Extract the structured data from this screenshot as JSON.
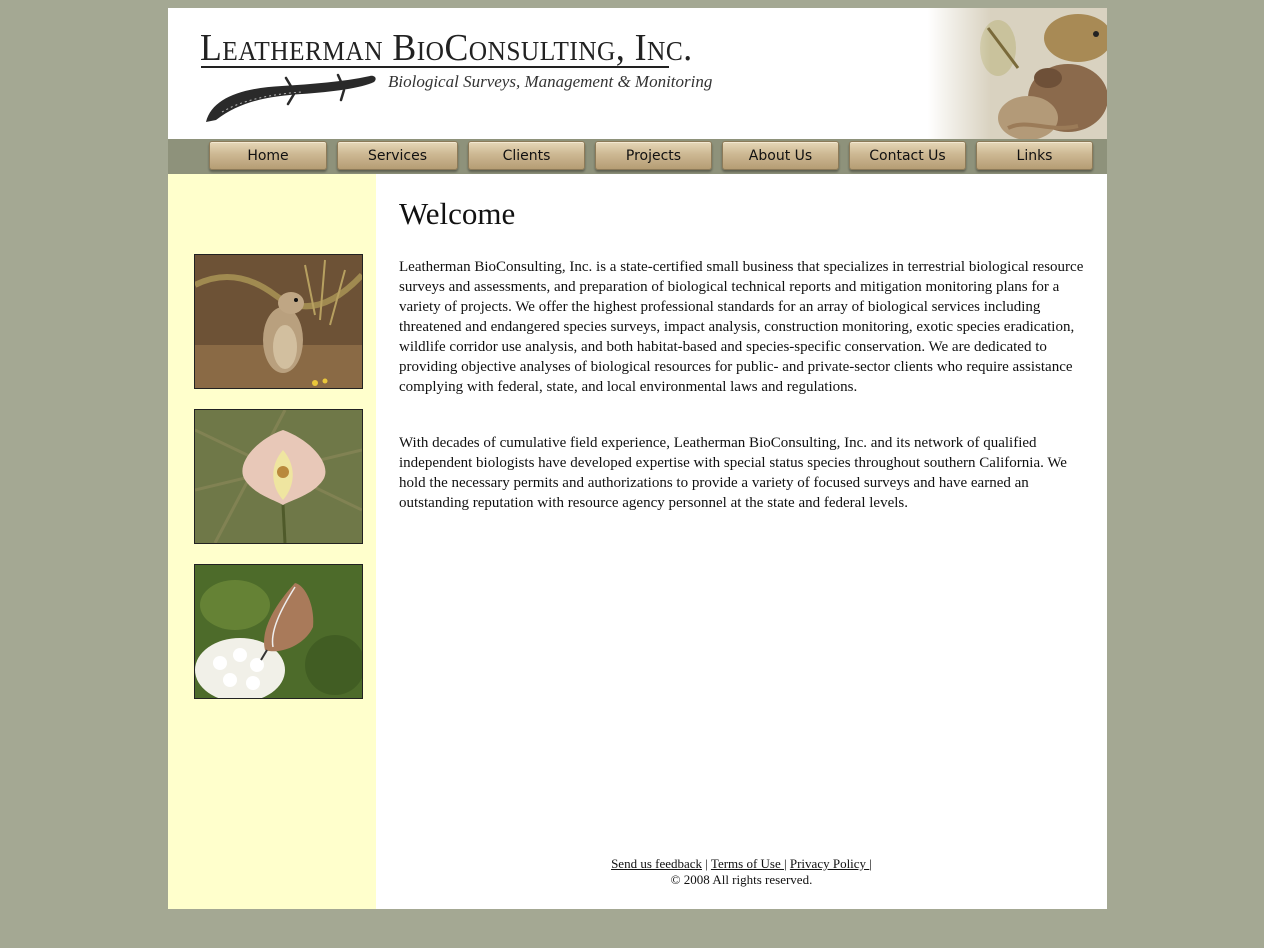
{
  "header": {
    "logo_title": "Leatherman BioConsulting, Inc.",
    "logo_tagline": "Biological Surveys, Management & Monitoring"
  },
  "nav": {
    "items": [
      {
        "label": "Home"
      },
      {
        "label": "Services"
      },
      {
        "label": "Clients"
      },
      {
        "label": "Projects"
      },
      {
        "label": "About Us"
      },
      {
        "label": "Contact Us"
      },
      {
        "label": "Links"
      }
    ]
  },
  "main": {
    "title": "Welcome",
    "paragraphs": [
      "Leatherman BioConsulting, Inc. is a state-certified small business that specializes in terrestrial biological resource surveys and assessments, and preparation of biological technical reports and mitigation monitoring plans for a variety of projects.  We offer the highest professional standards for an array of biological services including threatened and endangered species surveys, impact analysis, construction monitoring, exotic species eradication, wildlife corridor use analysis, and both habitat-based and species-specific conservation.  We are dedicated to providing objective analyses of biological resources for public- and private-sector clients who require assistance complying with federal, state, and local environmental laws and regulations.",
      "With decades of cumulative field experience, Leatherman BioConsulting, Inc. and its network of qualified independent biologists have developed expertise with special status species throughout southern California.  We hold the necessary permits and authorizations to provide a variety of focused surveys and have earned an outstanding reputation with resource agency personnel at the state and federal levels."
    ]
  },
  "footer": {
    "links": [
      {
        "label": "Send us feedback"
      },
      {
        "label": "Terms of Use "
      },
      {
        "label": "Privacy Policy "
      }
    ],
    "separator": "|",
    "copyright": "© 2008 All rights reserved."
  },
  "colors": {
    "background": "#a4a893",
    "sidebar": "#ffffcc",
    "navbar": "#8e927b",
    "nav_button": "#cdb893"
  }
}
